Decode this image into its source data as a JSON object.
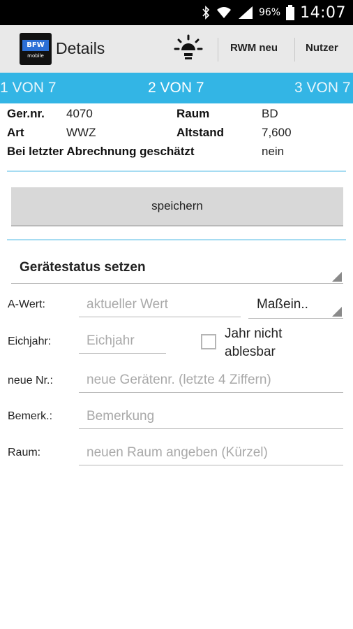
{
  "statusbar": {
    "battery": "96%",
    "time": "14:07",
    "icons": [
      "bluetooth-icon",
      "wifi-icon",
      "signal-icon",
      "battery-icon"
    ]
  },
  "actionbar": {
    "logo_top": "BFW",
    "logo_bottom": "mobile",
    "title": "Details",
    "bulb_icon": "light-bulb-icon",
    "rwm_label": "RWM neu",
    "nutzer_label": "Nutzer"
  },
  "pager": {
    "prev": "1 VON 7",
    "current": "2 VON 7",
    "next": "3 VON 7"
  },
  "info": {
    "gernr_label": "Ger.nr.",
    "gernr_value": "4070",
    "raum_label": "Raum",
    "raum_value": "BD",
    "art_label": "Art",
    "art_value": "WWZ",
    "altstand_label": "Altstand",
    "altstand_value": "7,600",
    "geschaetzt_label": "Bei letzter Abrechnung geschätzt",
    "geschaetzt_value": "nein"
  },
  "save_label": "speichern",
  "status_spinner": {
    "value": "Gerätestatus setzen"
  },
  "form": {
    "awert": {
      "label": "A-Wert:",
      "placeholder": "aktueller Wert"
    },
    "unit": {
      "value": "Maßein.."
    },
    "eichjahr": {
      "label": "Eichjahr:",
      "placeholder": "Eichjahr"
    },
    "jahr_checkbox": {
      "label": "Jahr nicht ablesbar",
      "checked": false
    },
    "neue_nr": {
      "label": "neue Nr.:",
      "placeholder": "neue Gerätenr. (letzte 4 Ziffern)"
    },
    "bemerk": {
      "label": "Bemerk.:",
      "placeholder": "Bemerkung"
    },
    "raum": {
      "label": "Raum:",
      "placeholder": "neuen Raum angeben (Kürzel)"
    }
  },
  "colors": {
    "accent": "#33b5e5",
    "divider": "#a6dcf2",
    "actionbar": "#e9e9e9"
  }
}
